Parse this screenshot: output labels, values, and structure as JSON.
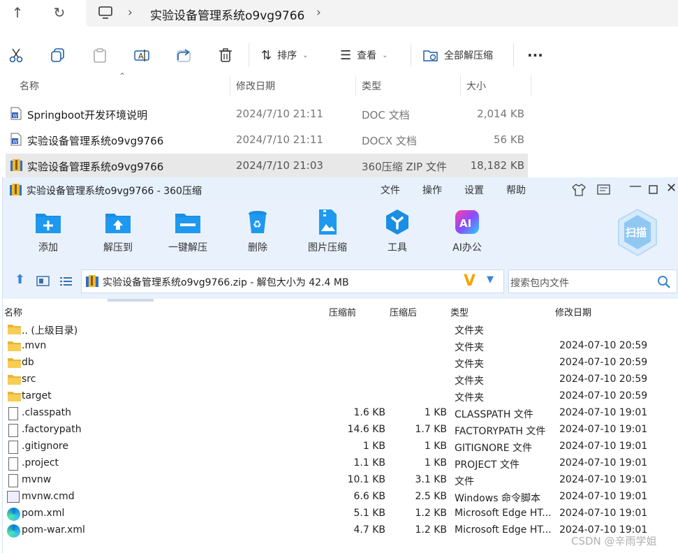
{
  "explorer": {
    "path": "实验设备管理系统o9vg9766",
    "toolbar": {
      "sort": "排序",
      "view": "查看",
      "extract_all": "全部解压缩"
    },
    "columns": {
      "name": "名称",
      "modified": "修改日期",
      "type": "类型",
      "size": "大小"
    },
    "files": [
      {
        "name": "Springboot开发环境说明",
        "date": "2024/7/10 21:11",
        "type": "DOC 文档",
        "size": "2,014 KB",
        "icon": "word-icon"
      },
      {
        "name": "实验设备管理系统o9vg9766",
        "date": "2024/7/10 21:11",
        "type": "DOCX 文档",
        "size": "56 KB",
        "icon": "word-icon"
      },
      {
        "name": "实验设备管理系统o9vg9766",
        "date": "2024/7/10 21:03",
        "type": "360压缩 ZIP 文件",
        "size": "18,182 KB",
        "icon": "zip-icon"
      }
    ]
  },
  "archiver": {
    "title": "实验设备管理系统o9vg9766 - 360压缩",
    "menu": [
      "文件",
      "操作",
      "设置",
      "帮助"
    ],
    "ribbon": [
      "添加",
      "解压到",
      "一键解压",
      "删除",
      "图片压缩",
      "工具",
      "AI办公"
    ],
    "scan_label": "扫描",
    "path_text": "实验设备管理系统o9vg9766.zip - 解包大小为 42.4 MB",
    "search_placeholder": "搜索包内文件",
    "columns": {
      "name": "名称",
      "before": "压缩前",
      "after": "压缩后",
      "type": "类型",
      "date": "修改日期"
    },
    "rows": [
      {
        "name": ".. (上级目录)",
        "before": "",
        "after": "",
        "type": "文件夹",
        "date": "",
        "icon": "folder-icon"
      },
      {
        "name": ".mvn",
        "before": "",
        "after": "",
        "type": "文件夹",
        "date": "2024-07-10 20:59",
        "icon": "folder-icon"
      },
      {
        "name": "db",
        "before": "",
        "after": "",
        "type": "文件夹",
        "date": "2024-07-10 20:59",
        "icon": "folder-icon"
      },
      {
        "name": "src",
        "before": "",
        "after": "",
        "type": "文件夹",
        "date": "2024-07-10 20:59",
        "icon": "folder-icon"
      },
      {
        "name": "target",
        "before": "",
        "after": "",
        "type": "文件夹",
        "date": "2024-07-10 20:59",
        "icon": "folder-icon"
      },
      {
        "name": ".classpath",
        "before": "1.6 KB",
        "after": "1 KB",
        "type": "CLASSPATH 文件",
        "date": "2024-07-10 19:01",
        "icon": "file-icon"
      },
      {
        "name": ".factorypath",
        "before": "14.6 KB",
        "after": "1.7 KB",
        "type": "FACTORYPATH 文件",
        "date": "2024-07-10 19:01",
        "icon": "file-icon"
      },
      {
        "name": ".gitignore",
        "before": "1 KB",
        "after": "1 KB",
        "type": "GITIGNORE 文件",
        "date": "2024-07-10 19:01",
        "icon": "file-icon"
      },
      {
        "name": ".project",
        "before": "1.1 KB",
        "after": "1 KB",
        "type": "PROJECT 文件",
        "date": "2024-07-10 19:01",
        "icon": "file-icon"
      },
      {
        "name": "mvnw",
        "before": "10.1 KB",
        "after": "3.1 KB",
        "type": "文件",
        "date": "2024-07-10 19:01",
        "icon": "file-icon"
      },
      {
        "name": "mvnw.cmd",
        "before": "6.6 KB",
        "after": "2.5 KB",
        "type": "Windows 命令脚本",
        "date": "2024-07-10 19:01",
        "icon": "cmd-icon"
      },
      {
        "name": "pom.xml",
        "before": "5.1 KB",
        "after": "1.2 KB",
        "type": "Microsoft Edge HT...",
        "date": "2024-07-10 19:01",
        "icon": "edge-icon"
      },
      {
        "name": "pom-war.xml",
        "before": "4.7 KB",
        "after": "1.2 KB",
        "type": "Microsoft Edge HT...",
        "date": "2024-07-10 19:01",
        "icon": "edge-icon"
      }
    ]
  },
  "watermark": "CSDN @辛雨学姐"
}
